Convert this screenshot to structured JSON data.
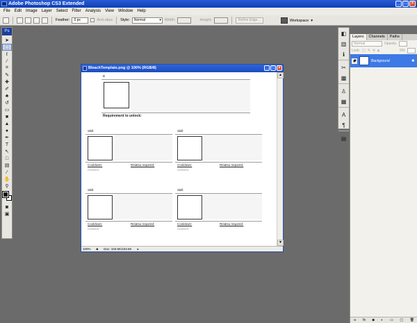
{
  "app": {
    "title": "Adobe Photoshop CS3 Extended"
  },
  "menu": [
    "File",
    "Edit",
    "Image",
    "Layer",
    "Select",
    "Filter",
    "Analysis",
    "View",
    "Window",
    "Help"
  ],
  "options_bar": {
    "feather_label": "Feather:",
    "feather_value": "0 px",
    "antialias_label": "Anti-alias",
    "style_label": "Style:",
    "style_value": "Normal",
    "width_label": "Width:",
    "height_label": "Height:",
    "refine_edge_label": "Refine Edge...",
    "workspace_label": "Workspace"
  },
  "document": {
    "title": "BleachTemplate.png @ 100% (RGB/8)",
    "zoom": "100%",
    "doc_size": "Doc: 103.6K/103.6K",
    "top_block": {
      "label": "B",
      "requirement": "Requirement to unlock:"
    },
    "skill_blocks": [
      {
        "label": "Skill:",
        "cooldown": "Cooldown:",
        "reiatsu": "Reiatsu required:",
        "classes": "Classes:"
      },
      {
        "label": "Skill:",
        "cooldown": "Cooldown:",
        "reiatsu": "Reiatsu required:",
        "classes": "Classes:"
      },
      {
        "label": "Skill:",
        "cooldown": "Cooldown:",
        "reiatsu": "Reiatsu required:",
        "classes": "Classes:"
      },
      {
        "label": "Skill:",
        "cooldown": "Cooldown:",
        "reiatsu": "Reiatsu required:",
        "classes": "Classes:"
      }
    ]
  },
  "layers_panel": {
    "tabs": [
      "Layers",
      "Channels",
      "Paths"
    ],
    "blend_mode": "Normal",
    "opacity_label": "Opacity:",
    "lock_label": "Lock:",
    "fill_label": "Fill:",
    "layer_name": "Background"
  },
  "colors": {
    "titlebar": "#0b3fb8",
    "workspace_bg": "#6b6b6b",
    "selected_layer": "#3d7ae6"
  }
}
